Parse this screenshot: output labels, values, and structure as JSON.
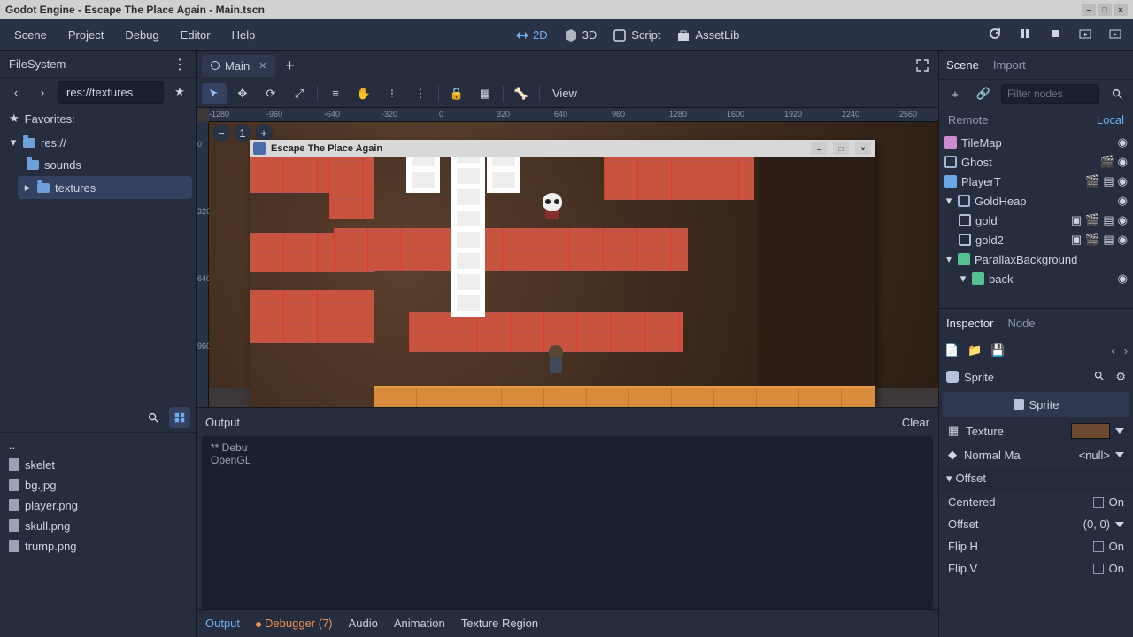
{
  "window": {
    "title": "Godot Engine - Escape The Place Again - Main.tscn"
  },
  "menubar": {
    "items": [
      "Scene",
      "Project",
      "Debug",
      "Editor",
      "Help"
    ],
    "modes": {
      "d2": "2D",
      "d3": "3D",
      "script": "Script",
      "assets": "AssetLib"
    }
  },
  "filesystem": {
    "tab": "FileSystem",
    "path": "res://textures",
    "favorites_label": "Favorites:",
    "root": "res://",
    "folders": [
      "sounds",
      "textures"
    ],
    "files_top": [
      "..",
      "skelet",
      "bg.jpg",
      "player.png",
      "skull.png",
      "trump.png"
    ]
  },
  "center": {
    "tab": "Main",
    "view_label": "View",
    "output": {
      "title": "Output",
      "clear": "Clear",
      "lines": [
        "**  Debu",
        "OpenGL "
      ],
      "tabs": {
        "output": "Output",
        "debugger": "Debugger (7)",
        "audio": "Audio",
        "animation": "Animation",
        "texture": "Texture Region"
      }
    },
    "ruler_h": [
      "-1280",
      "-960",
      "-640",
      "-320",
      "0",
      "320",
      "640",
      "960",
      "1280",
      "1600",
      "1920",
      "2240",
      "2560"
    ],
    "ruler_v": [
      "0",
      "320",
      "640",
      "960"
    ]
  },
  "game_window": {
    "title": "Escape The Place Again"
  },
  "scene": {
    "tabs": {
      "scene": "Scene",
      "import": "Import"
    },
    "filter_placeholder": "Filter nodes",
    "remote": "Remote",
    "local": "Local",
    "nodes": [
      {
        "name": "TileMap",
        "icon": "grid",
        "indent": 0,
        "eyes": [
          "eye"
        ]
      },
      {
        "name": "Ghost",
        "icon": "circle",
        "indent": 0,
        "eyes": [
          "scene",
          "eye"
        ]
      },
      {
        "name": "PlayerT",
        "icon": "player",
        "indent": 0,
        "eyes": [
          "scene",
          "script",
          "eye"
        ]
      },
      {
        "name": "GoldHeap",
        "icon": "circle",
        "indent": 0,
        "expand": true,
        "eyes": [
          "eye"
        ]
      },
      {
        "name": "gold",
        "icon": "node",
        "indent": 1,
        "eyes": [
          "sig",
          "scene",
          "script",
          "eye"
        ]
      },
      {
        "name": "gold2",
        "icon": "node",
        "indent": 1,
        "eyes": [
          "sig",
          "scene",
          "script",
          "eye"
        ]
      },
      {
        "name": "ParallaxBackground",
        "icon": "parallax",
        "indent": 0,
        "expand": true,
        "eyes": []
      },
      {
        "name": "back",
        "icon": "parallax",
        "indent": 1,
        "expand": true,
        "eyes": [
          "eye"
        ]
      }
    ]
  },
  "inspector": {
    "tabs": {
      "inspector": "Inspector",
      "node": "Node"
    },
    "object": "Sprite",
    "class": "Sprite",
    "props": {
      "texture": {
        "label": "Texture"
      },
      "normal": {
        "label": "Normal Ma",
        "value": "<null>"
      },
      "offset_cat": "Offset",
      "centered": {
        "label": "Centered",
        "value": "On"
      },
      "offset": {
        "label": "Offset",
        "value": "(0, 0)"
      },
      "fliph": {
        "label": "Flip H",
        "value": "On"
      },
      "flipv": {
        "label": "Flip V",
        "value": "On"
      }
    }
  }
}
